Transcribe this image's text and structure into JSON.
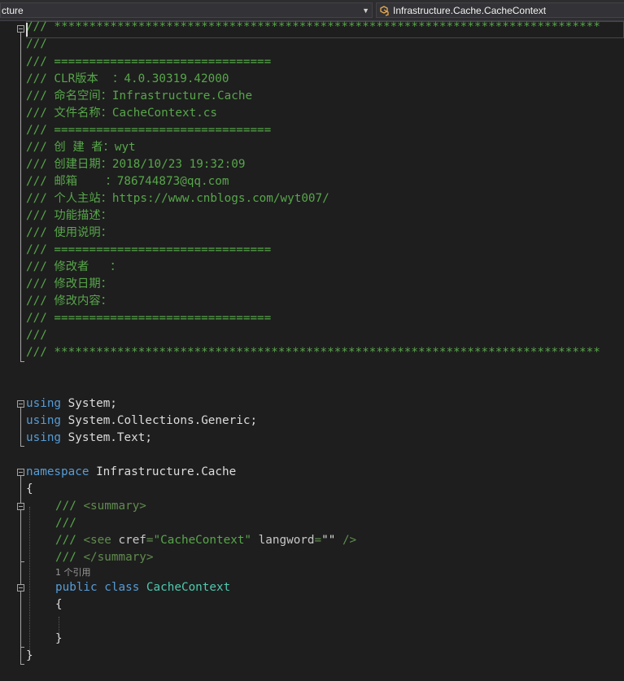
{
  "navbar": {
    "left_text": "cture",
    "right_text": "Infrastructure.Cache.CacheContext",
    "right_icon": "class-icon"
  },
  "header": {
    "stars": "/// ******************************************************************************",
    "blank": "///",
    "divider": "/// ===============================",
    "clr": "/// CLR版本  ：4.0.30319.42000",
    "namespace": "/// 命名空间：Infrastructure.Cache",
    "filename": "/// 文件名称：CacheContext.cs",
    "creator": "/// 创 建 者：wyt",
    "date": "/// 创建日期：2018/10/23 19:32:09",
    "email": "/// 邮箱    ：786744873@qq.com",
    "site": "/// 个人主站：https://www.cnblogs.com/wyt007/",
    "func": "/// 功能描述：",
    "usage": "/// 使用说明：",
    "modifier": "/// 修改者   ：",
    "mod_date": "/// 修改日期：",
    "mod_content": "/// 修改内容："
  },
  "usings": {
    "keyword": "using",
    "u1": " System;",
    "u2": " System.Collections.Generic;",
    "u3": " System.Text;"
  },
  "ns": {
    "keyword": "namespace",
    "name": " Infrastructure.Cache",
    "open": "{",
    "close": "}"
  },
  "doc": {
    "summary_open_prefix": "/// ",
    "summary_open_tag": "<summary>",
    "blank": "///",
    "see_prefix": "/// ",
    "see_tag_open": "<see",
    "see_attr1": " cref",
    "see_eq1": "=",
    "see_val1": "\"CacheContext\"",
    "see_attr2": " langword",
    "see_eq2": "=",
    "see_val2": "\"\"",
    "see_close": " />",
    "summary_close_prefix": "/// ",
    "summary_close_tag": "</summary>"
  },
  "codelens": "1 个引用",
  "cls": {
    "kw_public": "public",
    "kw_class": " class",
    "name": " CacheContext",
    "open": "{",
    "close": "}"
  }
}
